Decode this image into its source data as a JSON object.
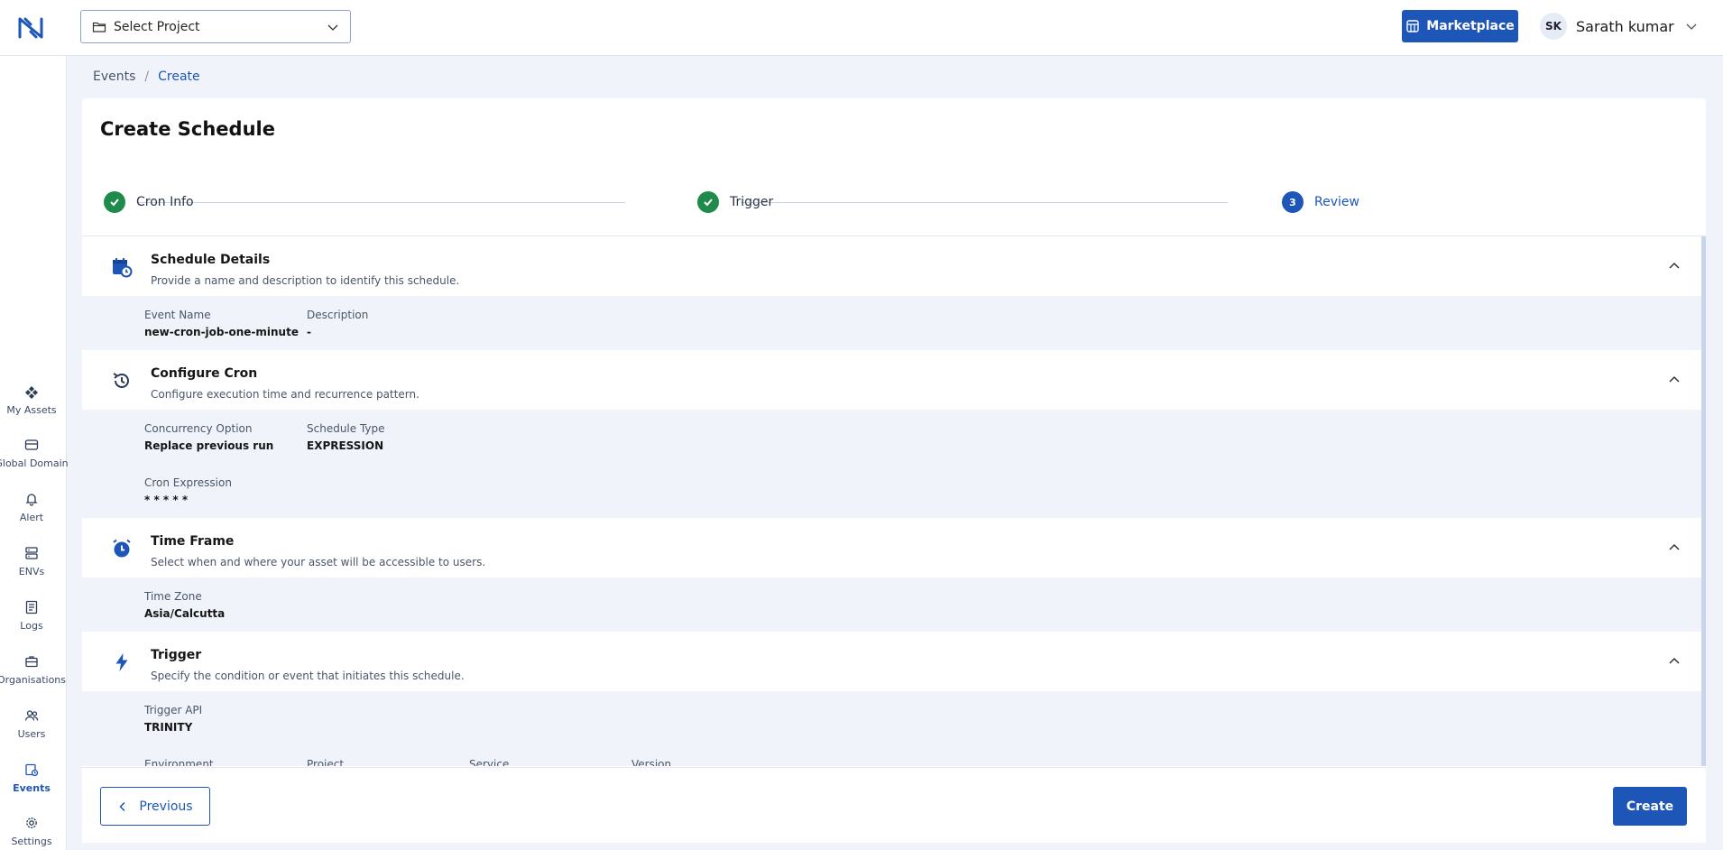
{
  "header": {
    "project_select_label": "Select Project",
    "marketplace_label": "Marketplace",
    "user_initials": "SK",
    "user_name": "Sarath kumar"
  },
  "sidebar": {
    "items": [
      {
        "label": "My Assets",
        "icon": "assets-icon"
      },
      {
        "label": "Global Domain",
        "icon": "globe-icon"
      },
      {
        "label": "Alert",
        "icon": "bell-icon"
      },
      {
        "label": "ENVs",
        "icon": "server-icon"
      },
      {
        "label": "Logs",
        "icon": "logs-icon"
      },
      {
        "label": "Organisations",
        "icon": "briefcase-icon"
      },
      {
        "label": "Users",
        "icon": "users-icon"
      },
      {
        "label": "Events",
        "icon": "events-icon",
        "active": true
      },
      {
        "label": "Settings",
        "icon": "gear-icon"
      }
    ]
  },
  "breadcrumb": {
    "parent": "Events",
    "separator": "/",
    "current": "Create"
  },
  "page": {
    "title": "Create Schedule"
  },
  "stepper": {
    "steps": [
      {
        "label": "Cron Info",
        "state": "done"
      },
      {
        "label": "Trigger",
        "state": "done"
      },
      {
        "label": "Review",
        "state": "current",
        "number": "3"
      }
    ]
  },
  "sections": {
    "schedule": {
      "title": "Schedule Details",
      "subtitle": "Provide a name and description to identify this schedule.",
      "fields": [
        {
          "label": "Event Name",
          "value": "new-cron-job-one-minute"
        },
        {
          "label": "Description",
          "value": "-"
        }
      ]
    },
    "cron": {
      "title": "Configure Cron",
      "subtitle": "Configure execution time and recurrence pattern.",
      "fields": [
        {
          "label": "Concurrency Option",
          "value": "Replace previous run"
        },
        {
          "label": "Schedule Type",
          "value": "EXPRESSION"
        },
        {
          "label": "Cron Expression",
          "value": "* * * * *"
        }
      ]
    },
    "timeframe": {
      "title": "Time Frame",
      "subtitle": "Select when and where your asset will be accessible to users.",
      "fields": [
        {
          "label": "Time Zone",
          "value": "Asia/Calcutta"
        }
      ]
    },
    "trigger": {
      "title": "Trigger",
      "subtitle": "Specify the condition or event that initiates this schedule.",
      "fields": [
        {
          "label": "Trigger API",
          "value": "TRINITY"
        },
        {
          "label": "Environment",
          "value": ""
        },
        {
          "label": "Project",
          "value": ""
        },
        {
          "label": "Service",
          "value": ""
        },
        {
          "label": "Version",
          "value": ""
        }
      ]
    }
  },
  "footer": {
    "previous_label": "Previous",
    "create_label": "Create"
  },
  "colors": {
    "primary": "#1e56b8",
    "success": "#1e8a4b",
    "background": "#f0f4fa"
  }
}
